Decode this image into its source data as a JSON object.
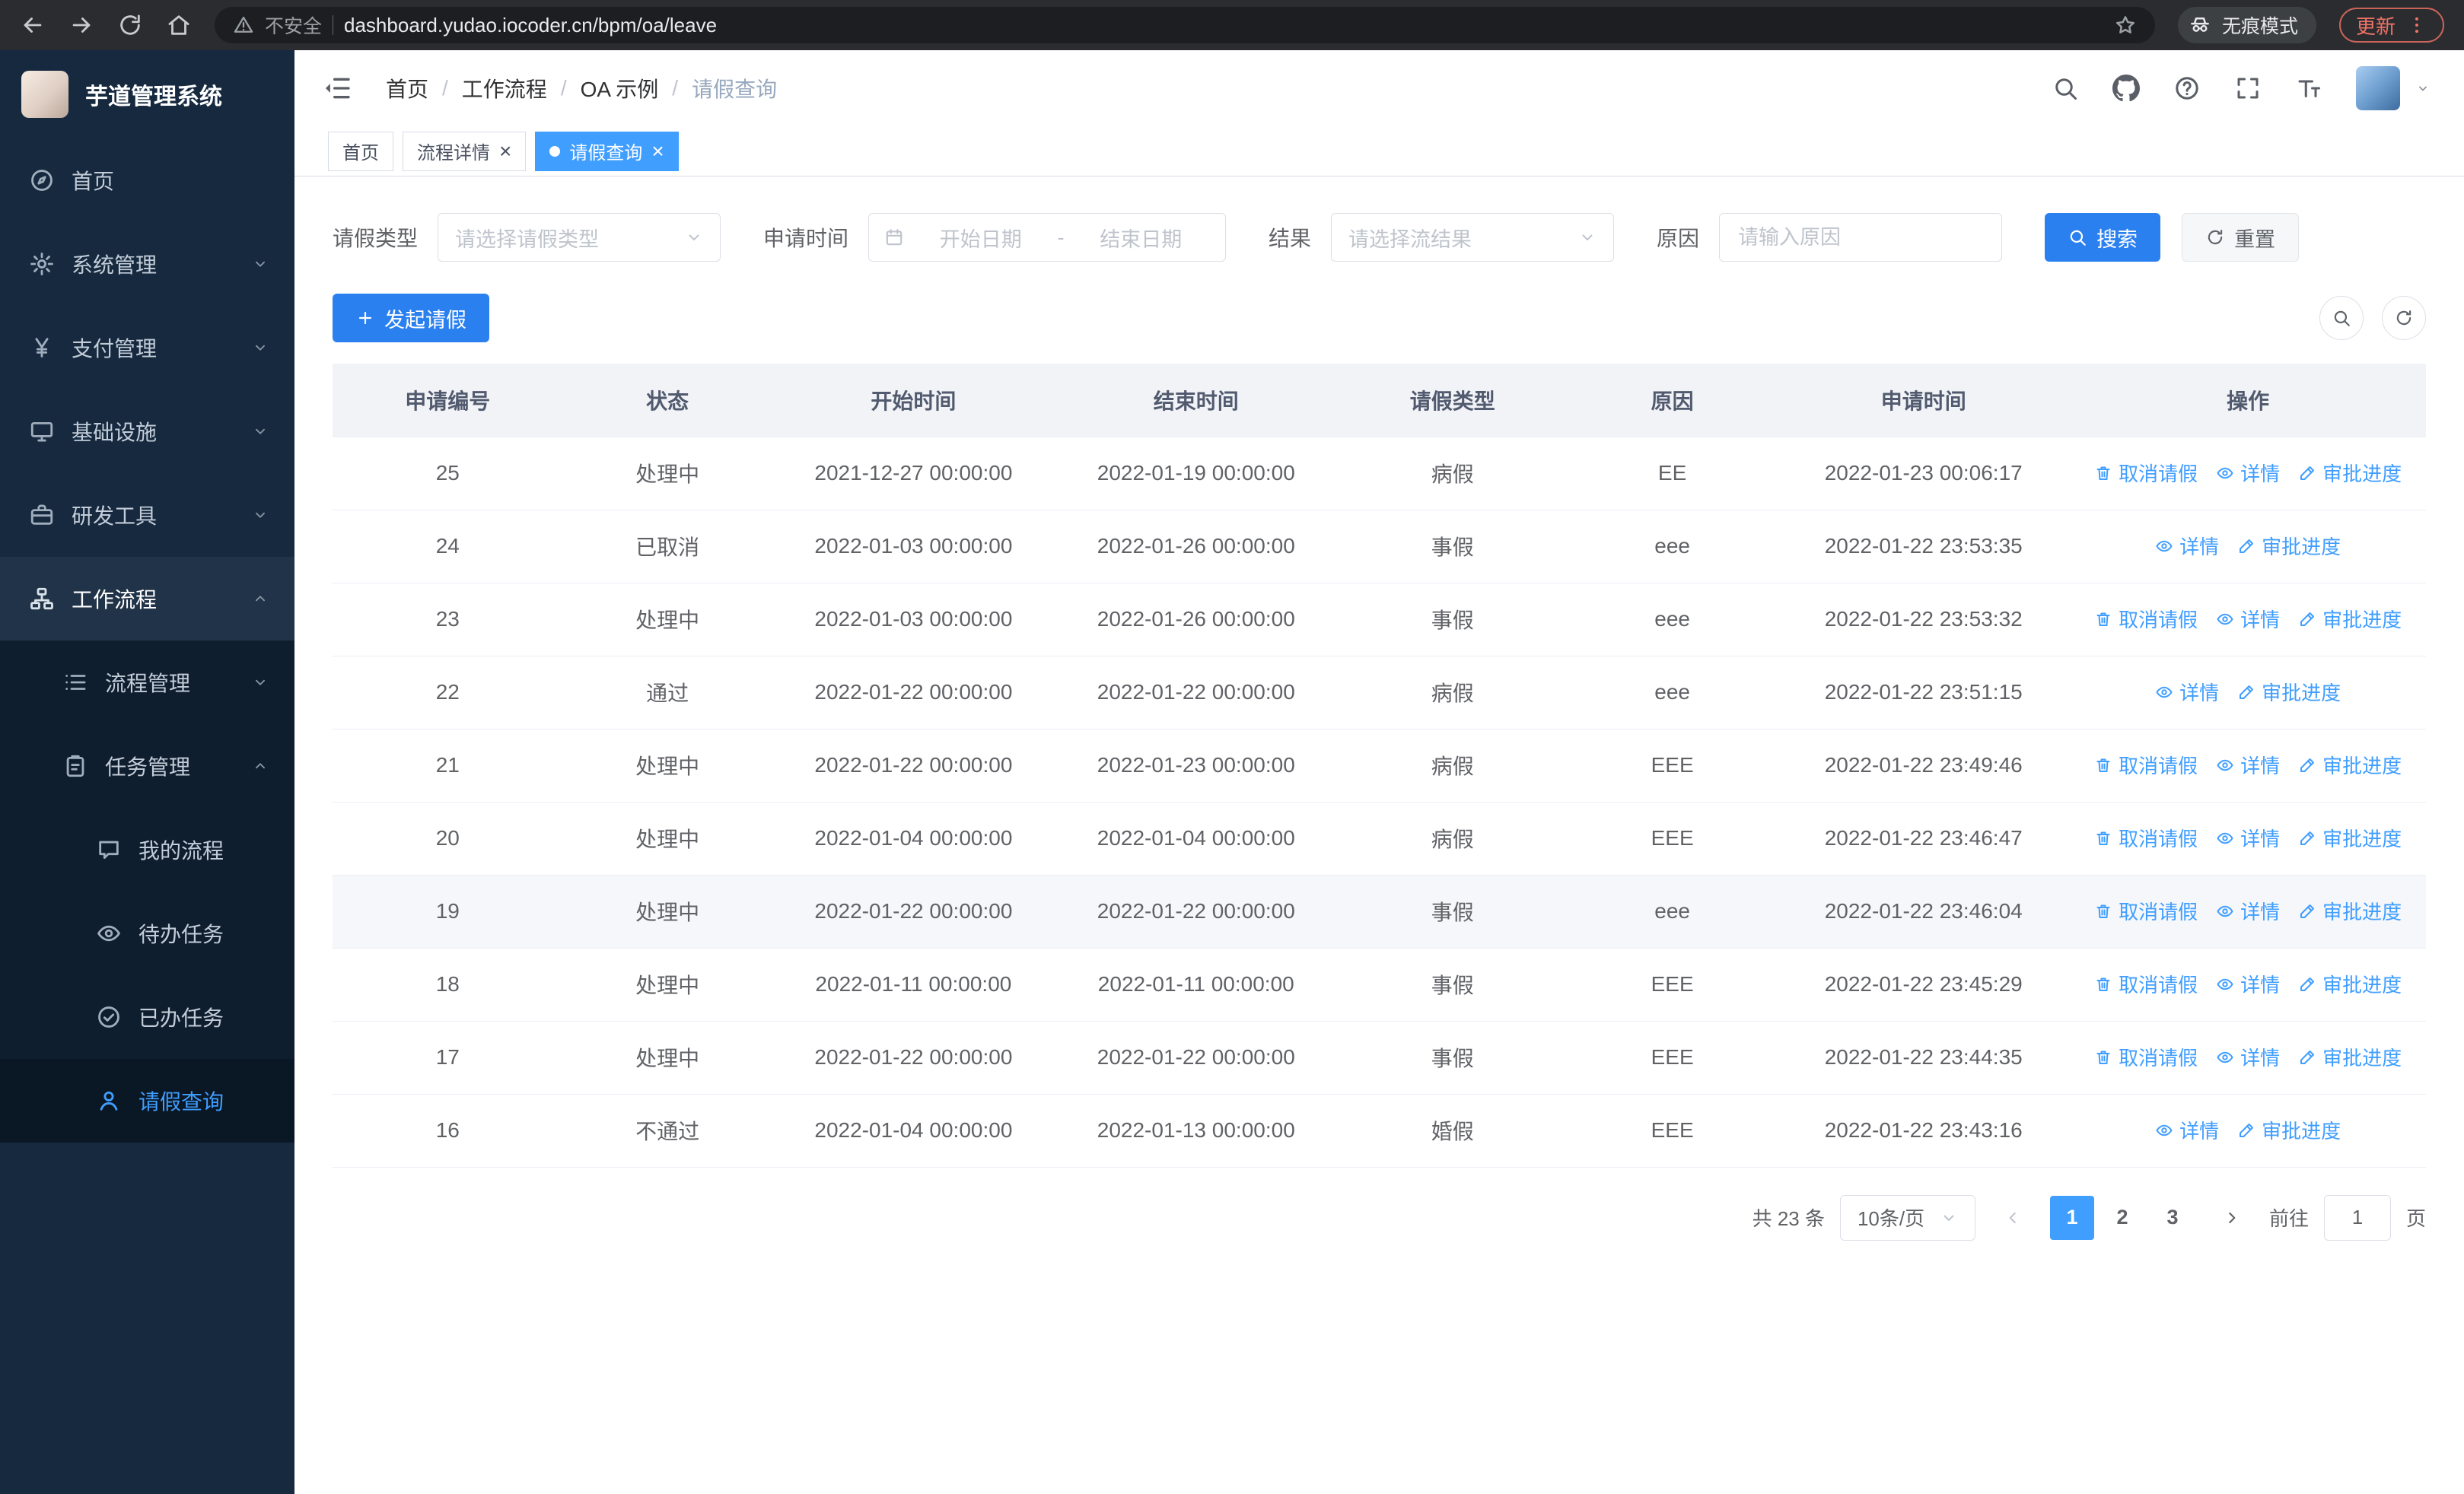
{
  "browser": {
    "security_label": "不安全",
    "url": "dashboard.yudao.iocoder.cn/bpm/oa/leave",
    "incognito_label": "无痕模式",
    "update_label": "更新"
  },
  "sidebar": {
    "logo_title": "芋道管理系统",
    "items": [
      {
        "name": "home",
        "label": "首页",
        "icon": "compass",
        "depth": 1
      },
      {
        "name": "system",
        "label": "系统管理",
        "icon": "gear",
        "depth": 1,
        "expandable": true,
        "expanded": false
      },
      {
        "name": "payment",
        "label": "支付管理",
        "icon": "yen",
        "depth": 1,
        "expandable": true,
        "expanded": false
      },
      {
        "name": "infrastructure",
        "label": "基础设施",
        "icon": "monitor",
        "depth": 1,
        "expandable": true,
        "expanded": false
      },
      {
        "name": "devtools",
        "label": "研发工具",
        "icon": "briefcase",
        "depth": 1,
        "expandable": true,
        "expanded": false
      },
      {
        "name": "workflow",
        "label": "工作流程",
        "icon": "orgchart",
        "depth": 1,
        "expandable": true,
        "expanded": true
      },
      {
        "name": "process-management",
        "label": "流程管理",
        "icon": "list",
        "depth": 2,
        "expandable": true,
        "expanded": false
      },
      {
        "name": "task-management",
        "label": "任务管理",
        "icon": "clipboard",
        "depth": 2,
        "expandable": true,
        "expanded": true
      },
      {
        "name": "my-process",
        "label": "我的流程",
        "icon": "chat",
        "depth": 3
      },
      {
        "name": "todo-task",
        "label": "待办任务",
        "icon": "eye",
        "depth": 3
      },
      {
        "name": "done-task",
        "label": "已办任务",
        "icon": "check-circle",
        "depth": 3
      },
      {
        "name": "leave-query",
        "label": "请假查询",
        "icon": "user",
        "depth": 3,
        "active": true
      }
    ]
  },
  "header": {
    "breadcrumb": [
      "首页",
      "工作流程",
      "OA 示例",
      "请假查询"
    ],
    "separator": "/",
    "actions": [
      {
        "name": "search",
        "icon": "search"
      },
      {
        "name": "github",
        "icon": "github"
      },
      {
        "name": "help",
        "icon": "question"
      },
      {
        "name": "fullscreen",
        "icon": "fullscreen"
      },
      {
        "name": "font-size",
        "icon": "fontsize"
      }
    ]
  },
  "tabs": [
    {
      "name": "home",
      "label": "首页",
      "closable": false,
      "active": false
    },
    {
      "name": "process-detail",
      "label": "流程详情",
      "closable": true,
      "active": false
    },
    {
      "name": "leave-query",
      "label": "请假查询",
      "closable": true,
      "active": true
    }
  ],
  "filters": {
    "leave_type": {
      "label": "请假类型",
      "placeholder": "请选择请假类型"
    },
    "apply_time": {
      "label": "申请时间",
      "start_placeholder": "开始日期",
      "separator": "-",
      "end_placeholder": "结束日期"
    },
    "result": {
      "label": "结果",
      "placeholder": "请选择流结果"
    },
    "reason": {
      "label": "原因",
      "placeholder": "请输入原因"
    },
    "search_label": "搜索",
    "reset_label": "重置"
  },
  "toolbar": {
    "create_label": "发起请假"
  },
  "table": {
    "columns": [
      "申请编号",
      "状态",
      "开始时间",
      "结束时间",
      "请假类型",
      "原因",
      "申请时间",
      "操作"
    ],
    "actions_meta": {
      "cancel": {
        "label": "取消请假",
        "icon": "trash"
      },
      "detail": {
        "label": "详情",
        "icon": "eye"
      },
      "progress": {
        "label": "审批进度",
        "icon": "edit"
      }
    },
    "rows": [
      {
        "id": "25",
        "status": "处理中",
        "start": "2021-12-27 00:00:00",
        "end": "2022-01-19 00:00:00",
        "type": "病假",
        "reason": "EE",
        "applied": "2022-01-23 00:06:17",
        "actions": [
          "cancel",
          "detail",
          "progress"
        ]
      },
      {
        "id": "24",
        "status": "已取消",
        "start": "2022-01-03 00:00:00",
        "end": "2022-01-26 00:00:00",
        "type": "事假",
        "reason": "eee",
        "applied": "2022-01-22 23:53:35",
        "actions": [
          "detail",
          "progress"
        ]
      },
      {
        "id": "23",
        "status": "处理中",
        "start": "2022-01-03 00:00:00",
        "end": "2022-01-26 00:00:00",
        "type": "事假",
        "reason": "eee",
        "applied": "2022-01-22 23:53:32",
        "actions": [
          "cancel",
          "detail",
          "progress"
        ]
      },
      {
        "id": "22",
        "status": "通过",
        "start": "2022-01-22 00:00:00",
        "end": "2022-01-22 00:00:00",
        "type": "病假",
        "reason": "eee",
        "applied": "2022-01-22 23:51:15",
        "actions": [
          "detail",
          "progress"
        ]
      },
      {
        "id": "21",
        "status": "处理中",
        "start": "2022-01-22 00:00:00",
        "end": "2022-01-23 00:00:00",
        "type": "病假",
        "reason": "EEE",
        "applied": "2022-01-22 23:49:46",
        "actions": [
          "cancel",
          "detail",
          "progress"
        ]
      },
      {
        "id": "20",
        "status": "处理中",
        "start": "2022-01-04 00:00:00",
        "end": "2022-01-04 00:00:00",
        "type": "病假",
        "reason": "EEE",
        "applied": "2022-01-22 23:46:47",
        "actions": [
          "cancel",
          "detail",
          "progress"
        ]
      },
      {
        "id": "19",
        "status": "处理中",
        "start": "2022-01-22 00:00:00",
        "end": "2022-01-22 00:00:00",
        "type": "事假",
        "reason": "eee",
        "applied": "2022-01-22 23:46:04",
        "actions": [
          "cancel",
          "detail",
          "progress"
        ],
        "highlighted": true
      },
      {
        "id": "18",
        "status": "处理中",
        "start": "2022-01-11 00:00:00",
        "end": "2022-01-11 00:00:00",
        "type": "事假",
        "reason": "EEE",
        "applied": "2022-01-22 23:45:29",
        "actions": [
          "cancel",
          "detail",
          "progress"
        ]
      },
      {
        "id": "17",
        "status": "处理中",
        "start": "2022-01-22 00:00:00",
        "end": "2022-01-22 00:00:00",
        "type": "事假",
        "reason": "EEE",
        "applied": "2022-01-22 23:44:35",
        "actions": [
          "cancel",
          "detail",
          "progress"
        ]
      },
      {
        "id": "16",
        "status": "不通过",
        "start": "2022-01-04 00:00:00",
        "end": "2022-01-13 00:00:00",
        "type": "婚假",
        "reason": "EEE",
        "applied": "2022-01-22 23:43:16",
        "actions": [
          "detail",
          "progress"
        ]
      }
    ]
  },
  "pagination": {
    "total_label": "共 23 条",
    "page_size": "10条/页",
    "pages": [
      "1",
      "2",
      "3"
    ],
    "active_page": "1",
    "goto_label": "前往",
    "goto_value": "1",
    "goto_suffix": "页"
  }
}
